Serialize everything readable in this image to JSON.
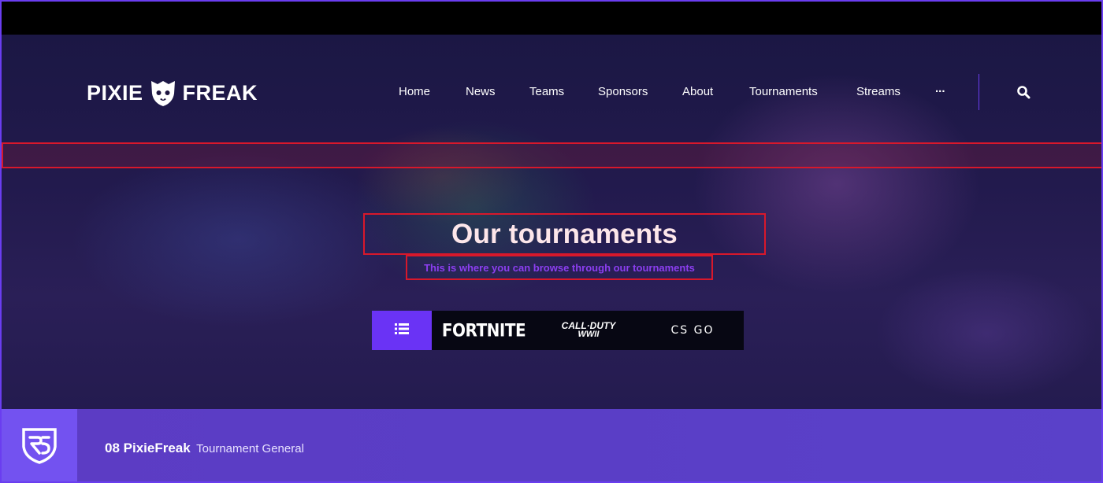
{
  "brand": {
    "left": "PIXIE",
    "right": "FREAK"
  },
  "nav": {
    "items": [
      {
        "label": "Home"
      },
      {
        "label": "News"
      },
      {
        "label": "Teams"
      },
      {
        "label": "Sponsors"
      },
      {
        "label": "About"
      },
      {
        "label": "Tournaments"
      },
      {
        "label": "Streams"
      },
      {
        "label": "..."
      }
    ],
    "search_icon": "search-icon"
  },
  "hero": {
    "title": "Our tournaments",
    "subtitle": "This is where you can browse through our tournaments"
  },
  "games": {
    "all_icon": "list-icon",
    "tabs": [
      {
        "label": "FORTNITE"
      },
      {
        "label_line1": "CALL·DUTY",
        "label_line2": "WWII"
      },
      {
        "label": "CS GO"
      }
    ]
  },
  "footer": {
    "logo_icon": "pixiefreak-shield-icon",
    "title": "08 PixieFreak",
    "subtitle": "Tournament General"
  },
  "colors": {
    "accent": "#6a33f5",
    "highlight_border": "#d8182b",
    "subtitle": "#8c3ef0",
    "footer": "#5c3cc4"
  }
}
